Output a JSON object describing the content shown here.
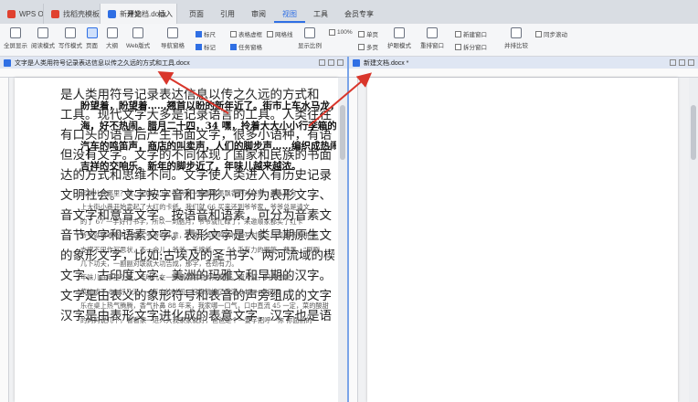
{
  "doc_tabs": [
    {
      "label": "WPS Office",
      "color": "#e0412f",
      "active": false
    },
    {
      "label": "找稻壳模板",
      "color": "#e0412f",
      "active": false
    },
    {
      "label": "新建文档.docx",
      "color": "#2f6fe4",
      "active": true
    }
  ],
  "ribbon_tabs": [
    "开始",
    "插入",
    "页面",
    "引用",
    "审阅",
    "视图",
    "工具",
    "会员专享"
  ],
  "active_ribbon_tab": "视图",
  "toolbar": {
    "tools": [
      "全屏显示",
      "阅读模式",
      "写作模式",
      "页面",
      "大纲",
      "Web版式",
      "导航窗格",
      "显示比例",
      "100%",
      "单页",
      "多页",
      "护眼模式",
      "重排窗口",
      "新建窗口",
      "拆分窗口",
      "并排比较",
      "同步滚动"
    ],
    "checkboxes": [
      {
        "label": "标尺",
        "checked": true
      },
      {
        "label": "表格虚框",
        "checked": false
      },
      {
        "label": "网格线",
        "checked": false
      },
      {
        "label": "标记",
        "checked": true
      },
      {
        "label": "任务窗格",
        "checked": true
      }
    ]
  },
  "left_pane": {
    "title": "文字是人类用符号记录表达信息以传之久远的方式和工具.docx",
    "lines": [
      "是人类用符号记录表达信息以传之久远的方式和",
      "工具。现代文字大多是记录语言的工具。人类往往",
      "有口头的语言后产生书面文字，很多小语种，有语",
      "但没有文字。文字的不同体现了国家和民族的书面",
      "达的方式和思维不同。文字使人类进入有历史记录",
      "文明社会。文字按字音和字形，可分为表形文字、",
      "音文字和意音文字。按语音和语素，可分为音素文",
      "音节文字和语素文字。表形文字是人类早期原生文",
      "的象形文字，比如:古埃及的圣书字、两河流域的楔",
      "文字、古印度文字、美洲的玛雅文和早期的汉字。",
      "文字是由表义的象形符号和表音的声旁组成的文字",
      "汉字是由表形文字进化成的表意文字，汉字也是语"
    ]
  },
  "right_pane": {
    "title": "新建文档.docx *",
    "bold_lines": [
      "盼望着，盼望着……翘首以盼的新年近了。街市上车水马龙，人",
      "海，好不热闹。腊月二十四，34 嘿，拎着大大小小行李箱的人在街上往",
      "汽车的鸣笛声，商店的叫卖声，人们的脚步声……编织成热闹",
      "吉祥的交响乐。新年的脚步近了，年味儿越来越浓。"
    ],
    "small_lines": [
      "年味儿在哪里？哦，年味儿 55 在节爷一幅幅笔墨飘香的对联里，进入腊月",
      "上大街小巷开始卖起了大红的卡纸，我们就 66 买来还到爷爷家，爷爷总是请文",
      "的了 67 一手好行书字，所以一到腊月，爷爷就忙碌了，来邀顺家都买了红卡",
      "爷爷就请爷爷写对联，爷爷也乐意，3 爱天笑呵呵的忙着写对联，只见爷爷 9 把毛",
      "支撑下巴作沉思状，不一会儿，爷爷一手按纸，一 54 手有力的握笔，蘸墨，“刷刷",
      "几下功夫，一副副对联就大功告成，那字，苍劲有力。",
      "年味儿在哪里？哦，年味儿在一桌桌香喷喷的菜肴里。腊月底，妈妈总会",
      "菜忙成了 86 好几天，一年中的时间，妈妈就嫁了满满 342 一桌子团",
      "乐在桌上热气腾腾，香气扑鼻 88 年来，我家哪一口气，口中直流 45 一定，菜的酸甜",
      "的妈妈说几下，看看家一进入大我家家就好，爸爸是个一要字招呼一你 你面前的"
    ]
  }
}
